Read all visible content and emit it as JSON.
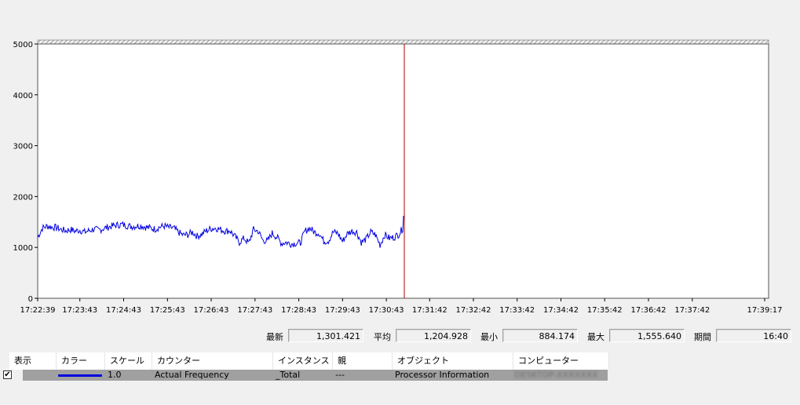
{
  "chart_data": {
    "type": "line",
    "y_ticks": [
      "5000",
      "4000",
      "3000",
      "2000",
      "1000",
      "0"
    ],
    "ylim": [
      0,
      5000
    ],
    "x_ticks": [
      "17:22:39",
      "17:23:43",
      "17:24:43",
      "17:25:43",
      "17:26:43",
      "17:27:43",
      "17:28:43",
      "17:29:43",
      "17:30:43",
      "17:31:42",
      "17:32:42",
      "17:33:42",
      "17:34:42",
      "17:35:42",
      "17:36:42",
      "17:37:42",
      "17:39:17"
    ],
    "series": [
      {
        "color": "#0000e0",
        "values": [
          1200,
          1380,
          1420,
          1400,
          1390,
          1350,
          1330,
          1350,
          1320,
          1340,
          1300,
          1330,
          1360,
          1340,
          1370,
          1400,
          1420,
          1440,
          1450,
          1430,
          1410,
          1420,
          1430,
          1400,
          1380,
          1360,
          1400,
          1420,
          1390,
          1380,
          1300,
          1240,
          1250,
          1300,
          1220,
          1260,
          1330,
          1370,
          1380,
          1350,
          1320,
          1330,
          1220,
          1100,
          1180,
          1080,
          1350,
          1320,
          1140,
          1120,
          1280,
          1200,
          1080,
          1100,
          1070,
          1080,
          1090,
          1320,
          1380,
          1300,
          1280,
          1120,
          1130,
          1300,
          1280,
          1120,
          1270,
          1320,
          1300,
          1100,
          1160,
          1300,
          1250,
          1050,
          1250,
          1180,
          1200,
          1260,
          1400
        ],
        "current_time_marker": "17:30:43"
      }
    ],
    "marker_color": "#b00000"
  },
  "stats": {
    "latest_label": "最新",
    "latest_value": "1,301.421",
    "avg_label": "平均",
    "avg_value": "1,204.928",
    "min_label": "最小",
    "min_value": "884.174",
    "max_label": "最大",
    "max_value": "1,555.640",
    "duration_label": "期間",
    "duration_value": "16:40"
  },
  "counter_table": {
    "headers": [
      "表示",
      "カラー",
      "スケール",
      "カウンター",
      "インスタンス",
      "親",
      "オブジェクト",
      "コンピューター"
    ],
    "rows": [
      {
        "show": "✔",
        "scale": "1.0",
        "counter": "Actual Frequency",
        "instance": "_Total",
        "parent": "---",
        "object": "Processor Information",
        "computer": "DESKTOP-XXXXXXX"
      }
    ]
  }
}
